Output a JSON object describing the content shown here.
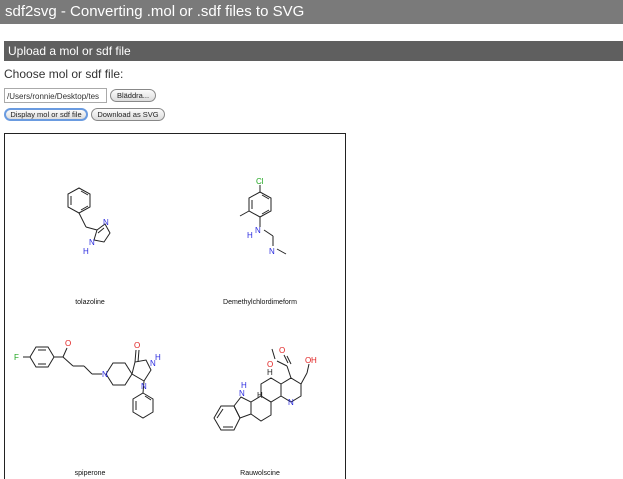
{
  "header": {
    "title": "sdf2svg - Converting .mol or .sdf files to SVG"
  },
  "upload": {
    "section_title": "Upload a mol or sdf file",
    "choose_label": "Choose mol or sdf file:",
    "file_path": "/Users/ronnie/Desktop/tes",
    "browse_label": "Bläddra...",
    "display_label": "Display mol or sdf file",
    "download_label": "Download as SVG"
  },
  "molecules": [
    {
      "name": "tolazoline"
    },
    {
      "name": "Demethylchlordimeform"
    },
    {
      "name": "spiperone"
    },
    {
      "name": "Rauwolscine"
    }
  ],
  "atom_labels": {
    "n": "N",
    "h": "H",
    "cl": "Cl",
    "f": "F",
    "o": "O"
  },
  "colors": {
    "nitrogen": "#2a2adf",
    "chlorine": "#1fa61f",
    "fluorine": "#1fa61f",
    "oxygen": "#e02020",
    "bond": "#222222"
  }
}
